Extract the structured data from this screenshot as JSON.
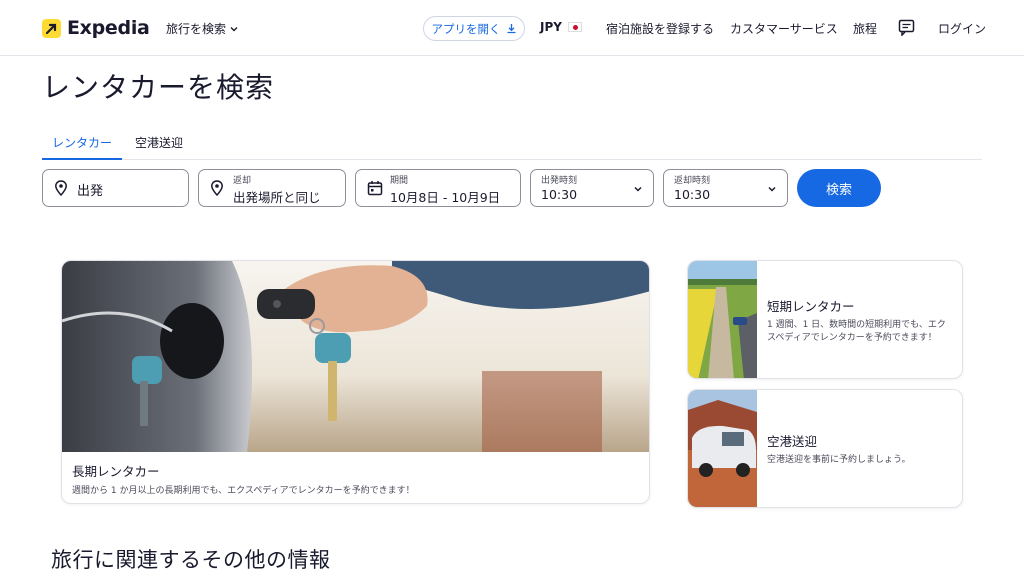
{
  "header": {
    "logo_text": "Expedia",
    "trip_search": "旅行を検索",
    "app_button": "アプリを開く",
    "currency": "JPY",
    "nav_links": [
      "宿泊施設を登録する",
      "カスタマーサービス",
      "旅程",
      "ログイン"
    ]
  },
  "page": {
    "title": "レンタカーを検索",
    "section_title": "旅行に関連するその他の情報"
  },
  "tabs": [
    {
      "label": "レンタカー",
      "active": true
    },
    {
      "label": "空港送迎",
      "active": false
    }
  ],
  "search": {
    "pickup_label": "出発",
    "dropoff_label": "返却",
    "dropoff_value": "出発場所と同じ",
    "dates_label": "期間",
    "dates_value": "10月8日 - 10月9日",
    "pickup_time_label": "出発時刻",
    "pickup_time_value": "10:30",
    "dropoff_time_label": "返却時刻",
    "dropoff_time_value": "10:30",
    "search_button": "検索"
  },
  "cards": {
    "long_term": {
      "title": "長期レンタカー",
      "desc": "週間から 1 か月以上の長期利用でも、エクスペディアでレンタカーを予約できます！"
    },
    "short_term": {
      "title": "短期レンタカー",
      "desc": "1 週間、1 日、数時間の短期利用でも、エクスペディアでレンタカーを予約できます！"
    },
    "airport": {
      "title": "空港送迎",
      "desc": "空港送迎を事前に予約しましょう。"
    }
  },
  "colors": {
    "accent": "#1668e3",
    "logo_yellow": "#fddb32",
    "text": "#1a1a2e"
  }
}
